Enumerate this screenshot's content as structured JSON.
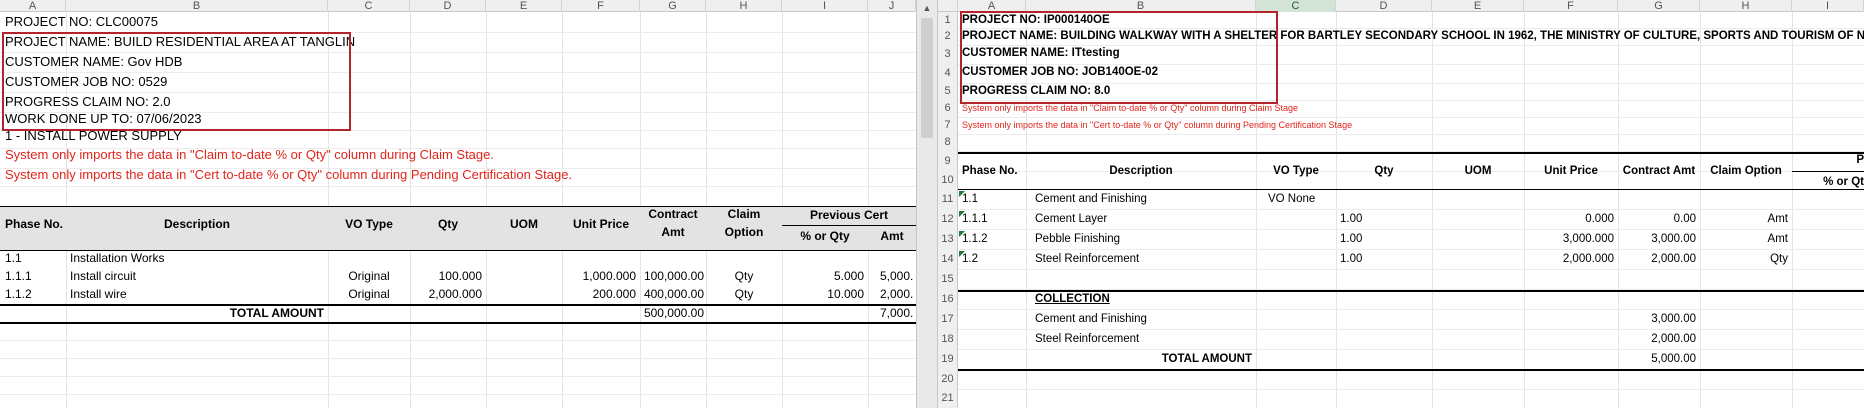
{
  "left": {
    "columns": [
      "A",
      "B",
      "C",
      "D",
      "E",
      "F",
      "G",
      "H",
      "I",
      "J"
    ],
    "project_no": "PROJECT NO: CLC00075",
    "project_name": "PROJECT NAME: BUILD RESIDENTIAL AREA AT TANGLIN",
    "customer_name": "CUSTOMER NAME: Gov HDB",
    "customer_job_no": "CUSTOMER JOB NO: 0529",
    "progress_claim_no": "PROGRESS CLAIM NO: 2.0",
    "work_done_up_to": "WORK DONE UP TO: 07/06/2023",
    "section": "1 - INSTALL POWER SUPPLY",
    "note1": "System only imports the data in \"Claim to-date % or Qty\" column during Claim Stage.",
    "note2": "System only imports the data in \"Cert to-date % or Qty\" column during Pending Certification Stage.",
    "headers": {
      "phase": "Phase No.",
      "desc": "Description",
      "vo": "VO Type",
      "qty": "Qty",
      "uom": "UOM",
      "price": "Unit Price",
      "contract1": "Contract",
      "contract2": "Amt",
      "claim1": "Claim",
      "claim2": "Option",
      "prev": "Previous Cert",
      "pct": "% or Qty",
      "amt": "Amt"
    },
    "rows": [
      {
        "phase": "1.1",
        "desc": "Installation Works",
        "vo": "",
        "qty": "",
        "uom": "",
        "price": "",
        "contract": "",
        "claim": "",
        "pct": "",
        "amt": ""
      },
      {
        "phase": "1.1.1",
        "desc": "Install circuit",
        "vo": "Original",
        "qty": "100.000",
        "uom": "",
        "price": "1,000.000",
        "contract": "100,000.00",
        "claim": "Qty",
        "pct": "5.000",
        "amt": "5,000."
      },
      {
        "phase": "1.1.2",
        "desc": "Install wire",
        "vo": "Original",
        "qty": "2,000.000",
        "uom": "",
        "price": "200.000",
        "contract": "400,000.00",
        "claim": "Qty",
        "pct": "10.000",
        "amt": "2,000."
      }
    ],
    "total_label": "TOTAL AMOUNT",
    "total_contract": "500,000.00",
    "total_amt": "7,000."
  },
  "right": {
    "columns": [
      "A",
      "B",
      "C",
      "D",
      "E",
      "F",
      "G",
      "H",
      "I"
    ],
    "row_numbers": [
      "1",
      "2",
      "3",
      "4",
      "5",
      "6",
      "7",
      "8",
      "9",
      "10",
      "11",
      "12",
      "13",
      "14",
      "15",
      "16",
      "17",
      "18",
      "19",
      "20",
      "21"
    ],
    "project_no": "PROJECT NO: IP000140OE",
    "project_name": "PROJECT NAME: BUILDING WALKWAY WITH A SHELTER FOR BARTLEY SECONDARY SCHOOL IN 1962, THE MINISTRY OF CULTURE, SPORTS AND TOURISM OF NOR",
    "customer_name": "CUSTOMER NAME: ITtesting",
    "customer_job_no": "CUSTOMER JOB NO: JOB140OE-02",
    "progress_claim_no": "PROGRESS CLAIM NO: 8.0",
    "note1": "System only imports the data in \"Claim to-date % or Qty\" column during Claim Stage",
    "note2": "System only imports the data in \"Cert to-date % or Qty\" column during Pending Certification Stage",
    "headers": {
      "phase": "Phase No.",
      "desc": "Description",
      "vo": "VO Type",
      "qty": "Qty",
      "uom": "UOM",
      "price": "Unit Price",
      "contract": "Contract Amt",
      "claim": "Claim Option",
      "p": "P",
      "pct": "% or Qt"
    },
    "rows": [
      {
        "phase": "1.1",
        "desc": "Cement and Finishing",
        "vo": "VO None",
        "qty": "",
        "price": "",
        "contract": "",
        "claim": ""
      },
      {
        "phase": "1.1.1",
        "desc": "Cement Layer",
        "vo": "",
        "qty": "1.00",
        "price": "0.000",
        "contract": "0.00",
        "claim": "Amt"
      },
      {
        "phase": "1.1.2",
        "desc": "Pebble Finishing",
        "vo": "",
        "qty": "1.00",
        "price": "3,000.000",
        "contract": "3,000.00",
        "claim": "Amt"
      },
      {
        "phase": "1.2",
        "desc": "Steel Reinforcement",
        "vo": "",
        "qty": "1.00",
        "price": "2,000.000",
        "contract": "2,000.00",
        "claim": "Qty"
      }
    ],
    "collection_label": "COLLECTION",
    "collection": [
      {
        "desc": "Cement and Finishing",
        "amount": "3,000.00"
      },
      {
        "desc": "Steel Reinforcement",
        "amount": "2,000.00"
      }
    ],
    "total_label": "TOTAL AMOUNT",
    "total_amount": "5,000.00"
  }
}
